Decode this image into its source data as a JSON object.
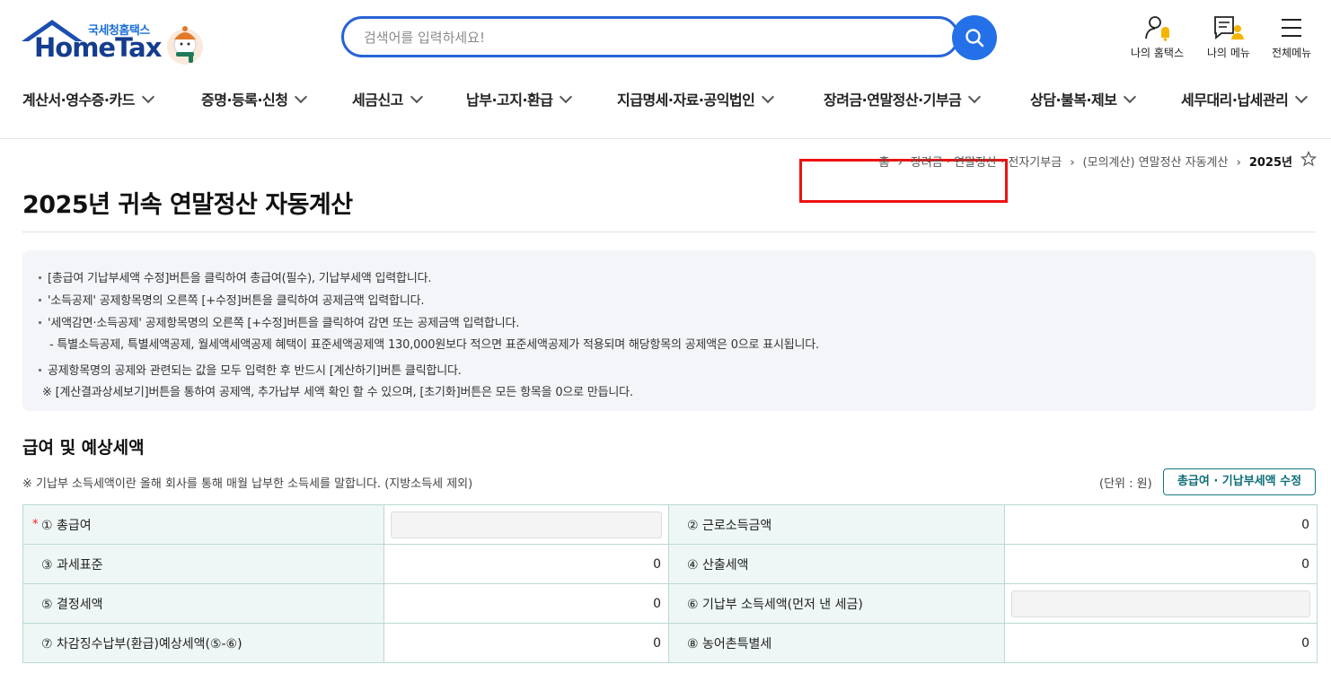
{
  "logo": {
    "sub": "국세청홈택스",
    "main": "HomeTax"
  },
  "search": {
    "placeholder": "검색어를 입력하세요!"
  },
  "util": {
    "my_hometax": "나의 홈택스",
    "my_menu": "나의 메뉴",
    "all_menu": "전체메뉴"
  },
  "gnb": {
    "items": [
      "계산서·영수증·카드",
      "증명·등록·신청",
      "세금신고",
      "납부·고지·환급",
      "지급명세·자료·공익법인",
      "장려금·연말정산·기부금",
      "상담·불복·제보",
      "세무대리·납세관리"
    ],
    "highlight_color": "#ee1111"
  },
  "breadcrumb": {
    "home": "홈",
    "level1": "장려금 · 연말정산 · 전자기부금",
    "level2": "(모의계산) 연말정산 자동계산",
    "current": "2025년"
  },
  "page": {
    "title": "2025년 귀속 연말정산 자동계산"
  },
  "notice": {
    "lines": [
      "[총급여 기납부세액 수정]버튼을 클릭하여 총급여(필수), 기납부세액 입력합니다.",
      "'소득공제' 공제항목명의 오른쪽 [+수정]버튼을 클릭하여 공제금액 입력합니다.",
      "'세액감면·소득공제' 공제항목명의 오른쪽 [+수정]버튼을 클릭하여 감면 또는 공제금액 입력합니다.",
      "- 특별소득공제, 특별세액공제, 월세액세액공제 혜택이 표준세액공제액 130,000원보다 적으면 표준세액공제가 적용되며 해당항목의 공제액은 0으로 표시됩니다.",
      "공제항목명의 공제와 관련되는 값을 모두 입력한 후 반드시 [계산하기]버튼 클릭합니다.",
      "※ [계산결과상세보기]버튼을 통하여 공제액, 추가납부 세액 확인 할 수 있으며, [초기화]버튼은 모든 항목을 0으로 만듭니다."
    ]
  },
  "section": {
    "title": "급여 및 예상세액",
    "note": "※ 기납부 소득세액이란 올해 회사를 통해 매월 납부한 소득세를 말합니다. (지방소득세 제외)",
    "unit": "(단위 : 원)",
    "edit_button": "총급여 · 기납부세액 수정"
  },
  "grid": {
    "required_mark": "*",
    "rows": [
      {
        "l1": "① 총급여",
        "v1": "",
        "l2": "② 근로소득금액",
        "v2": "0"
      },
      {
        "l1": "③ 과세표준",
        "v1": "0",
        "l2": "④ 산출세액",
        "v2": "0"
      },
      {
        "l1": "⑤ 결정세액",
        "v1": "0",
        "l2": "⑥ 기납부 소득세액(먼저 낸 세금)",
        "v2": ""
      },
      {
        "l1": "⑦ 차감징수납부(환급)예상세액(⑤-⑥)",
        "v1": "0",
        "l2": "⑧ 농어촌특별세",
        "v2": "0"
      }
    ]
  }
}
